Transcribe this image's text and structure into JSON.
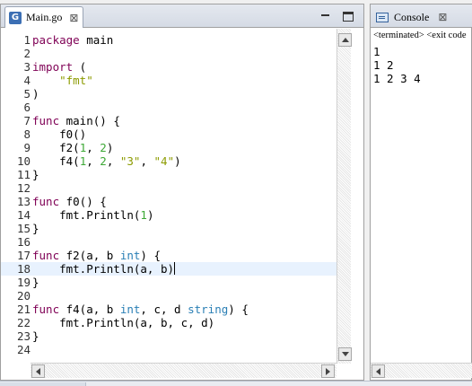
{
  "editor": {
    "tab_icon_glyph": "G",
    "tab_title": "Main.go",
    "close_glyph": "⊠",
    "lines": [
      {
        "n": "1",
        "tokens": [
          {
            "t": "package",
            "c": "kw"
          },
          {
            "t": " main",
            "c": ""
          }
        ]
      },
      {
        "n": "2",
        "tokens": []
      },
      {
        "n": "3",
        "tokens": [
          {
            "t": "import",
            "c": "kw"
          },
          {
            "t": " (",
            "c": ""
          }
        ]
      },
      {
        "n": "4",
        "tokens": [
          {
            "t": "    ",
            "c": ""
          },
          {
            "t": "\"fmt\"",
            "c": "str"
          }
        ]
      },
      {
        "n": "5",
        "tokens": [
          {
            "t": ")",
            "c": ""
          }
        ]
      },
      {
        "n": "6",
        "tokens": []
      },
      {
        "n": "7",
        "tokens": [
          {
            "t": "func",
            "c": "kw"
          },
          {
            "t": " main() {",
            "c": ""
          }
        ]
      },
      {
        "n": "8",
        "tokens": [
          {
            "t": "    f0()",
            "c": ""
          }
        ]
      },
      {
        "n": "9",
        "tokens": [
          {
            "t": "    f2(",
            "c": ""
          },
          {
            "t": "1",
            "c": "num"
          },
          {
            "t": ", ",
            "c": ""
          },
          {
            "t": "2",
            "c": "num"
          },
          {
            "t": ")",
            "c": ""
          }
        ]
      },
      {
        "n": "10",
        "tokens": [
          {
            "t": "    f4(",
            "c": ""
          },
          {
            "t": "1",
            "c": "num"
          },
          {
            "t": ", ",
            "c": ""
          },
          {
            "t": "2",
            "c": "num"
          },
          {
            "t": ", ",
            "c": ""
          },
          {
            "t": "\"3\"",
            "c": "str"
          },
          {
            "t": ", ",
            "c": ""
          },
          {
            "t": "\"4\"",
            "c": "str"
          },
          {
            "t": ")",
            "c": ""
          }
        ]
      },
      {
        "n": "11",
        "tokens": [
          {
            "t": "}",
            "c": ""
          }
        ]
      },
      {
        "n": "12",
        "tokens": []
      },
      {
        "n": "13",
        "tokens": [
          {
            "t": "func",
            "c": "kw"
          },
          {
            "t": " f0() {",
            "c": ""
          }
        ]
      },
      {
        "n": "14",
        "tokens": [
          {
            "t": "    fmt.Println(",
            "c": ""
          },
          {
            "t": "1",
            "c": "num"
          },
          {
            "t": ")",
            "c": ""
          }
        ]
      },
      {
        "n": "15",
        "tokens": [
          {
            "t": "}",
            "c": ""
          }
        ]
      },
      {
        "n": "16",
        "tokens": []
      },
      {
        "n": "17",
        "tokens": [
          {
            "t": "func",
            "c": "kw"
          },
          {
            "t": " f2(a, b ",
            "c": ""
          },
          {
            "t": "int",
            "c": "type"
          },
          {
            "t": ") {",
            "c": ""
          }
        ]
      },
      {
        "n": "18",
        "current": true,
        "tokens": [
          {
            "t": "    fmt.Println(a, b)",
            "c": ""
          }
        ]
      },
      {
        "n": "19",
        "tokens": [
          {
            "t": "}",
            "c": ""
          }
        ]
      },
      {
        "n": "20",
        "tokens": []
      },
      {
        "n": "21",
        "tokens": [
          {
            "t": "func",
            "c": "kw"
          },
          {
            "t": " f4(a, b ",
            "c": ""
          },
          {
            "t": "int",
            "c": "type"
          },
          {
            "t": ", c, d ",
            "c": ""
          },
          {
            "t": "string",
            "c": "type"
          },
          {
            "t": ") {",
            "c": ""
          }
        ]
      },
      {
        "n": "22",
        "tokens": [
          {
            "t": "    fmt.Println(a, b, c, d)",
            "c": ""
          }
        ]
      },
      {
        "n": "23",
        "tokens": [
          {
            "t": "}",
            "c": ""
          }
        ]
      },
      {
        "n": "24",
        "tokens": []
      }
    ]
  },
  "console": {
    "tab_title": "Console",
    "close_glyph": "⊠",
    "status": "<terminated> <exit code",
    "output": [
      "1",
      "1 2",
      "1 2 3 4"
    ]
  },
  "colors": {
    "keyword": "#7f0055",
    "type": "#2a7fb5",
    "string": "#8c9b00",
    "number": "#3da836",
    "current_line": "#e8f2fe"
  }
}
